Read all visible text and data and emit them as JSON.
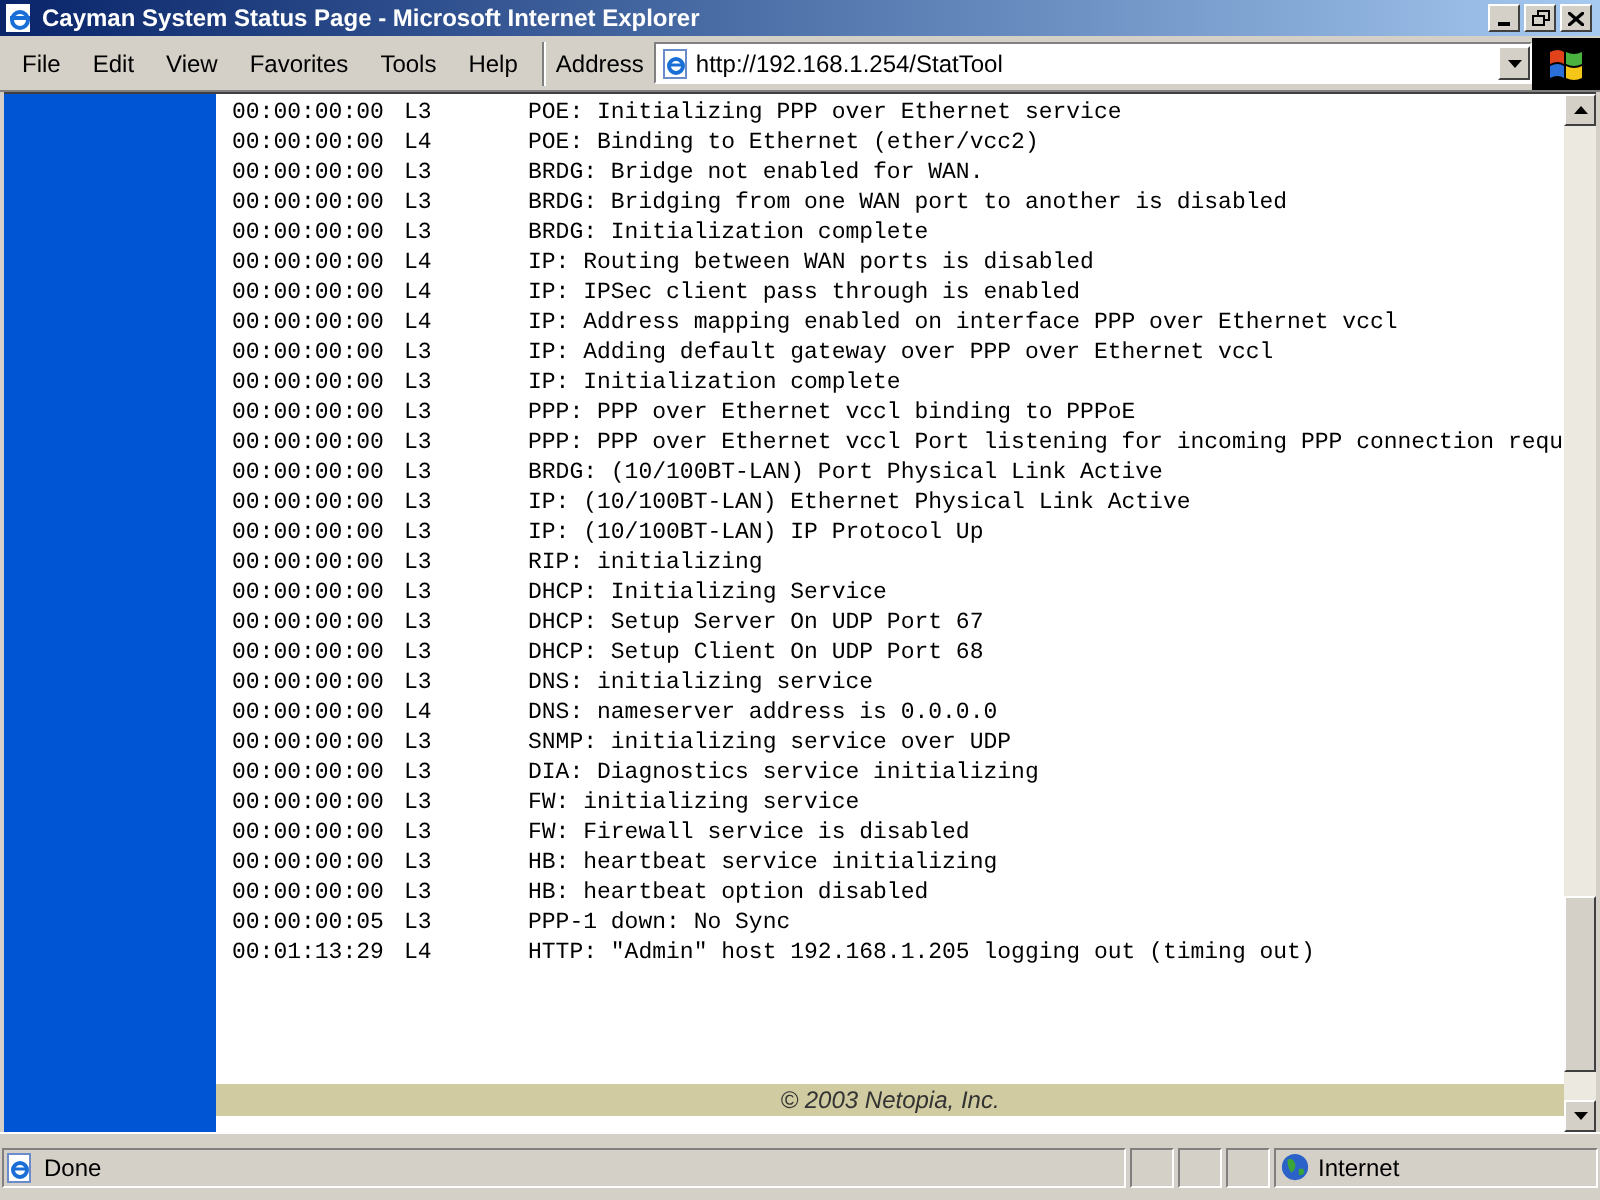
{
  "window": {
    "title": "Cayman System Status Page - Microsoft Internet Explorer"
  },
  "menu": [
    "File",
    "Edit",
    "View",
    "Favorites",
    "Tools",
    "Help"
  ],
  "address": {
    "label": "Address",
    "value": "http://192.168.1.254/StatTool"
  },
  "log": [
    {
      "time": "00:00:00:00",
      "level": "L3",
      "message": "POE: Initializing PPP over Ethernet service"
    },
    {
      "time": "00:00:00:00",
      "level": "L4",
      "message": "POE: Binding to Ethernet (ether/vcc2)"
    },
    {
      "time": "00:00:00:00",
      "level": "L3",
      "message": "BRDG: Bridge not enabled for WAN."
    },
    {
      "time": "00:00:00:00",
      "level": "L3",
      "message": "BRDG: Bridging from one WAN port to another is disabled"
    },
    {
      "time": "00:00:00:00",
      "level": "L3",
      "message": "BRDG: Initialization complete"
    },
    {
      "time": "00:00:00:00",
      "level": "L4",
      "message": "IP: Routing between WAN ports is disabled"
    },
    {
      "time": "00:00:00:00",
      "level": "L4",
      "message": "IP: IPSec client pass through is enabled"
    },
    {
      "time": "00:00:00:00",
      "level": "L4",
      "message": "IP: Address mapping enabled on interface PPP over Ethernet vccl"
    },
    {
      "time": "00:00:00:00",
      "level": "L3",
      "message": "IP: Adding default gateway over PPP over Ethernet vccl"
    },
    {
      "time": "00:00:00:00",
      "level": "L3",
      "message": "IP: Initialization complete"
    },
    {
      "time": "00:00:00:00",
      "level": "L3",
      "message": "PPP: PPP over Ethernet vccl binding to PPPoE"
    },
    {
      "time": "00:00:00:00",
      "level": "L3",
      "message": "PPP: PPP over Ethernet vccl Port listening for incoming PPP connection requ"
    },
    {
      "time": "00:00:00:00",
      "level": "L3",
      "message": "BRDG: (10/100BT-LAN) Port Physical Link Active"
    },
    {
      "time": "00:00:00:00",
      "level": "L3",
      "message": "IP: (10/100BT-LAN) Ethernet Physical Link Active"
    },
    {
      "time": "00:00:00:00",
      "level": "L3",
      "message": "IP: (10/100BT-LAN) IP Protocol Up"
    },
    {
      "time": "00:00:00:00",
      "level": "L3",
      "message": "RIP: initializing"
    },
    {
      "time": "00:00:00:00",
      "level": "L3",
      "message": "DHCP: Initializing Service"
    },
    {
      "time": "00:00:00:00",
      "level": "L3",
      "message": "DHCP: Setup Server On UDP Port 67"
    },
    {
      "time": "00:00:00:00",
      "level": "L3",
      "message": "DHCP: Setup Client On UDP Port 68"
    },
    {
      "time": "00:00:00:00",
      "level": "L3",
      "message": "DNS: initializing service"
    },
    {
      "time": "00:00:00:00",
      "level": "L4",
      "message": "DNS: nameserver address is 0.0.0.0"
    },
    {
      "time": "00:00:00:00",
      "level": "L3",
      "message": "SNMP: initializing service over UDP"
    },
    {
      "time": "00:00:00:00",
      "level": "L3",
      "message": "DIA: Diagnostics service initializing"
    },
    {
      "time": "00:00:00:00",
      "level": "L3",
      "message": "FW: initializing service"
    },
    {
      "time": "00:00:00:00",
      "level": "L3",
      "message": "FW: Firewall service is disabled"
    },
    {
      "time": "00:00:00:00",
      "level": "L3",
      "message": "HB: heartbeat service initializing"
    },
    {
      "time": "00:00:00:00",
      "level": "L3",
      "message": "HB: heartbeat option disabled"
    },
    {
      "time": "00:00:00:05",
      "level": "L3",
      "message": "PPP-1 down: No Sync"
    },
    {
      "time": "00:01:13:29",
      "level": "L4",
      "message": "HTTP: \"Admin\" host 192.168.1.205 logging out (timing out)"
    }
  ],
  "footer": "© 2003 Netopia, Inc.",
  "status_bar": {
    "text": "Done",
    "zone": "Internet"
  }
}
